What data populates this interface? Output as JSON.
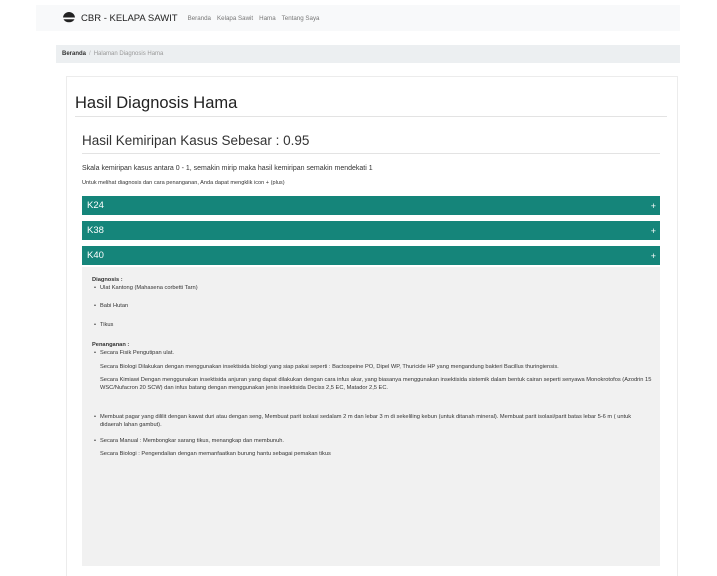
{
  "navbar": {
    "brand": "CBR - KELAPA SAWIT",
    "links": [
      "Beranda",
      "Kelapa Sawit",
      "Hama",
      "Tentang Saya"
    ]
  },
  "breadcrumb": {
    "home": "Beranda",
    "separator": "/",
    "current": "Halaman Diagnosis Hama"
  },
  "page": {
    "title": "Hasil Diagnosis Hama",
    "subtitle": "Hasil Kemiripan Kasus Sebesar : 0.95",
    "note1": "Skala kemiripan kasus antara 0 - 1, semakin mirip maka hasil kemiripan semakin mendekati 1",
    "note2": "Untuk melihat diagnosis dan cara penanganan, Anda dapat mengklik icon + (plus)"
  },
  "accordion": [
    {
      "label": "K24",
      "icon": "+"
    },
    {
      "label": "K38",
      "icon": "+"
    },
    {
      "label": "K40",
      "icon": "+"
    }
  ],
  "detail": {
    "diagnosis_heading": "Diagnosis :",
    "diagnosis": [
      "Ulat Kantong (Mahasena corbetti Tarn)",
      "Babi Hutan",
      "Tikus"
    ],
    "treatment_heading": "Penanganan :",
    "t1_item": "Secara Fisik Pengutipan ulat.",
    "t1_para1": "Secara Biologi Dilakukan dengan menggunakan insektisida biologi yang siap pakai seperti : Bactospeine PO, Dipel WP, Thuricide HP yang mengandung bakteri Bacillus thuringiensis.",
    "t1_para2": "Secara Kimiawi Dengan menggunakan insektisida anjuran yang dapat dilakukan dengan cara infus akar, yang biasanya menggunakan insektisida sistemik dalam bentuk cairan seperti senyawa Monokrotofos (Azodrin 15 WSC/Nufacron 20 SCW) dan infus batang dengan menggunakan jenis insektisida Deciss 2,5 EC, Matador 2,5 EC.",
    "t2_item": "Membuat pagar yang dililit dengan kawat duri atau dengan seng, Membuat parit isolasi sedalam 2 m dan lebar 3 m di sekeliling kebun (untuk ditanah mineral). Membuat parit isolasi/parit batas lebar 5-6 m ( untuk didaerah lahan gambut).",
    "t3_item": "Secara Manual : Membongkar sarang tikus, menangkap dan membunuh.",
    "t3_para": "Secara Biologi : Pengendalian dengan memanfaatkan burung hantu sebagai pemakan tikus"
  },
  "colors": {
    "accent": "#15857a",
    "navbar_bg": "#f8f9fa",
    "panel_bg": "#f1f1f1"
  }
}
